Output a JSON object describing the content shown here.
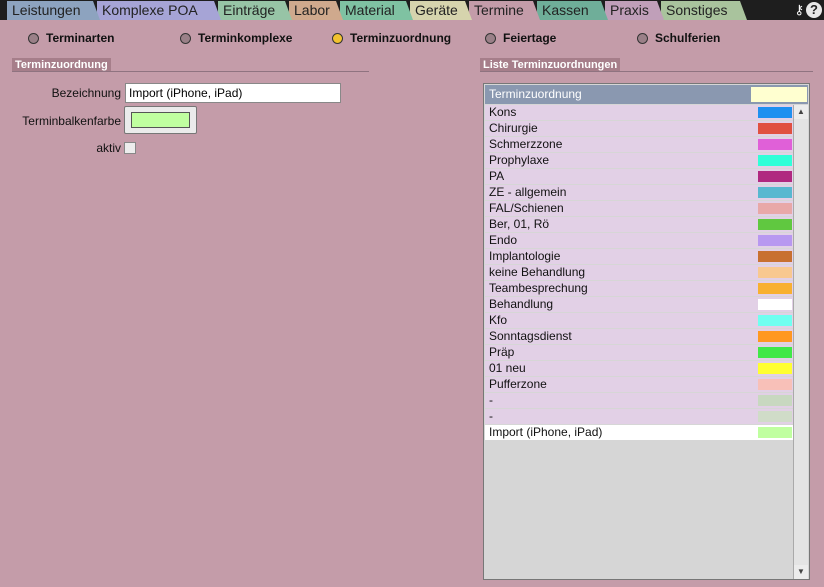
{
  "tabs": [
    {
      "label": "Leistungen",
      "color": "#8da3bf",
      "active": false
    },
    {
      "label": "Komplexe POA",
      "color": "#a6a4d6",
      "active": false
    },
    {
      "label": "Einträge",
      "color": "#97c4a6",
      "active": false
    },
    {
      "label": "Labor",
      "color": "#cfa98d",
      "active": false
    },
    {
      "label": "Material",
      "color": "#7fc2a2",
      "active": false
    },
    {
      "label": "Geräte",
      "color": "#d6d4ad",
      "active": false
    },
    {
      "label": "Termine",
      "color": "#c49ca9",
      "active": true
    },
    {
      "label": "Kassen",
      "color": "#6fae99",
      "active": false
    },
    {
      "label": "Praxis",
      "color": "#c09fb9",
      "active": false
    },
    {
      "label": "Sonstiges",
      "color": "#a9c39d",
      "active": false
    }
  ],
  "top_icons": {
    "key_icon": "key-icon",
    "help_icon": "help-icon",
    "key_glyph": "⚷",
    "help_glyph": "?"
  },
  "radio_options": [
    {
      "label": "Terminarten",
      "checked": false
    },
    {
      "label": "Terminkomplexe",
      "checked": false
    },
    {
      "label": "Terminzuordnung",
      "checked": true
    },
    {
      "label": "Feiertage",
      "checked": false
    },
    {
      "label": "Schulferien",
      "checked": false
    }
  ],
  "form": {
    "section_title": "Terminzuordnung",
    "bezeichnung_label": "Bezeichnung",
    "bezeichnung_value": "Import (iPhone, iPad)",
    "farbe_label": "Terminbalkenfarbe",
    "farbe_value": "#c0ffa0",
    "aktiv_label": "aktiv",
    "aktiv_checked": false
  },
  "list": {
    "section_title": "Liste Terminzuordnungen",
    "column_header": "Terminzuordnung",
    "header_color": "#ffffd0",
    "items": [
      {
        "label": "Kons",
        "color": "#1e90f0"
      },
      {
        "label": "Chirurgie",
        "color": "#e05040"
      },
      {
        "label": "Schmerzzone",
        "color": "#e060d8"
      },
      {
        "label": "Prophylaxe",
        "color": "#30ffd8"
      },
      {
        "label": "PA",
        "color": "#b02880"
      },
      {
        "label": "ZE - allgemein",
        "color": "#58b8d0"
      },
      {
        "label": "FAL/Schienen",
        "color": "#e8a8a8"
      },
      {
        "label": "Ber, 01, Rö",
        "color": "#60c840"
      },
      {
        "label": "Endo",
        "color": "#b898f0"
      },
      {
        "label": "Implantologie",
        "color": "#c87030"
      },
      {
        "label": "keine Behandlung",
        "color": "#f8c890"
      },
      {
        "label": "Teambesprechung",
        "color": "#f8b030"
      },
      {
        "label": "Behandlung",
        "color": "#ffffff"
      },
      {
        "label": "Kfo",
        "color": "#70fff0"
      },
      {
        "label": "Sonntagsdienst",
        "color": "#ff9820"
      },
      {
        "label": "Präp",
        "color": "#40e848"
      },
      {
        "label": "01 neu",
        "color": "#ffff30"
      },
      {
        "label": "Pufferzone",
        "color": "#f8c0b8"
      },
      {
        "label": "-",
        "color": "#c8d8c0"
      },
      {
        "label": "-",
        "color": "#d0dcc8"
      },
      {
        "label": "Import (iPhone, iPad)",
        "color": "#c0ffa0",
        "selected": true
      }
    ],
    "scroll_up_glyph": "▲",
    "scroll_down_glyph": "▼"
  }
}
